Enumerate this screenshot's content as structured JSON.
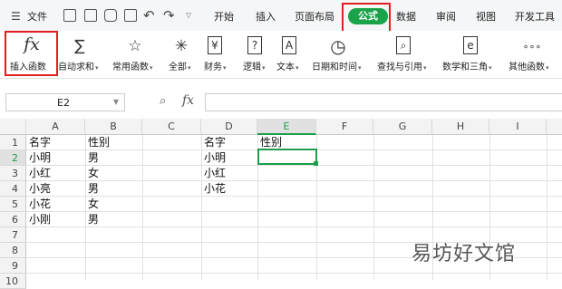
{
  "menubar": {
    "file_label": "文件",
    "tabs": [
      "开始",
      "插入",
      "页面布局",
      "公式",
      "数据",
      "审阅",
      "视图",
      "开发工具"
    ],
    "active_tab": "公式"
  },
  "ribbon": {
    "items": [
      {
        "label": "插入函数",
        "icon": "fx-icon",
        "glyph": "fx"
      },
      {
        "label": "自动求和",
        "icon": "sigma-icon",
        "glyph": "∑"
      },
      {
        "label": "常用函数",
        "icon": "star-icon",
        "glyph": "☆"
      },
      {
        "label": "全部",
        "icon": "asterisk-icon",
        "glyph": "✳"
      },
      {
        "label": "财务",
        "icon": "yen-book-icon",
        "glyph": "¥"
      },
      {
        "label": "逻辑",
        "icon": "question-book-icon",
        "glyph": "?"
      },
      {
        "label": "文本",
        "icon": "text-book-icon",
        "glyph": "A"
      },
      {
        "label": "日期和时间",
        "icon": "clock-icon",
        "glyph": "◷"
      },
      {
        "label": "查找与引用",
        "icon": "search-book-icon",
        "glyph": "⌕"
      },
      {
        "label": "数学和三角",
        "icon": "math-book-icon",
        "glyph": "e"
      },
      {
        "label": "其他函数",
        "icon": "more-icon",
        "glyph": "∘∘∘"
      }
    ]
  },
  "formula_bar": {
    "name_box": "E2",
    "fx_label": "fx",
    "formula": ""
  },
  "grid": {
    "columns": [
      "A",
      "B",
      "C",
      "D",
      "E",
      "F",
      "G",
      "H",
      "I"
    ],
    "rows": [
      "1",
      "2",
      "3",
      "4",
      "5",
      "6",
      "7",
      "8",
      "9",
      "10"
    ],
    "selected_cell": "E2",
    "cells": {
      "A1": "名字",
      "B1": "性别",
      "D1": "名字",
      "E1": "性别",
      "A2": "小明",
      "B2": "男",
      "D2": "小明",
      "A3": "小红",
      "B3": "女",
      "D3": "小红",
      "A4": "小亮",
      "B4": "男",
      "D4": "小花",
      "A5": "小花",
      "B5": "女",
      "A6": "小刚",
      "B6": "男"
    }
  },
  "watermark": "易坊好文馆",
  "colors": {
    "accent": "#1aa34a",
    "highlight": "#e02020"
  }
}
